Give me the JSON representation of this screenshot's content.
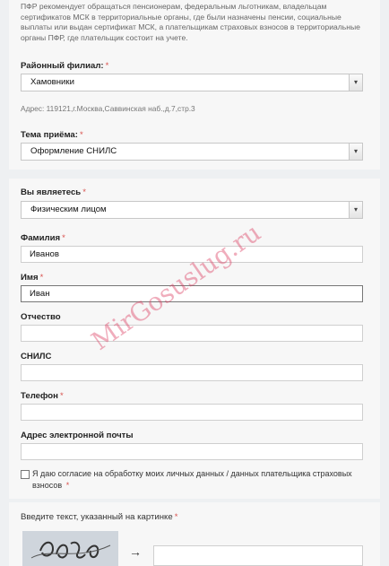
{
  "intro": "ПФР рекомендует обращаться пенсионерам, федеральным льготникам, владельцам сертификатов МСК в территориальные органы, где были назначены пенсии, социальные выплаты или выдан сертификат МСК, а плательщикам страховых взносов в территориальные органы ПФР, где плательщик состоит на учете.",
  "branch": {
    "label": "Районный филиал:",
    "value": "Хамовники",
    "address": "Адрес: 119121,г.Москва,Саввинская наб.,д.7,стр.3"
  },
  "topic": {
    "label": "Тема приёма:",
    "value": "Оформление СНИЛС"
  },
  "person_type": {
    "label": "Вы являетесь",
    "value": "Физическим лицом"
  },
  "surname": {
    "label": "Фамилия",
    "value": "Иванов"
  },
  "name": {
    "label": "Имя",
    "value": "Иван"
  },
  "patronymic": {
    "label": "Отчество",
    "value": ""
  },
  "snils": {
    "label": "СНИЛС",
    "value": ""
  },
  "phone": {
    "label": "Телефон",
    "value": ""
  },
  "email": {
    "label": "Адрес электронной почты",
    "value": ""
  },
  "consent": {
    "text": "Я даю согласие на обработку моих личных данных / данных плательщика страховых взносов"
  },
  "captcha": {
    "label": "Введите текст, указанный на картинке",
    "arrow": "→",
    "value": ""
  },
  "required_mark": "*",
  "dropdown_arrow": "▾",
  "watermark": "MirGosuslug.ru",
  "colors": {
    "required": "#d9534f",
    "background": "#eef0f2",
    "watermark": "#dc3c5f"
  }
}
